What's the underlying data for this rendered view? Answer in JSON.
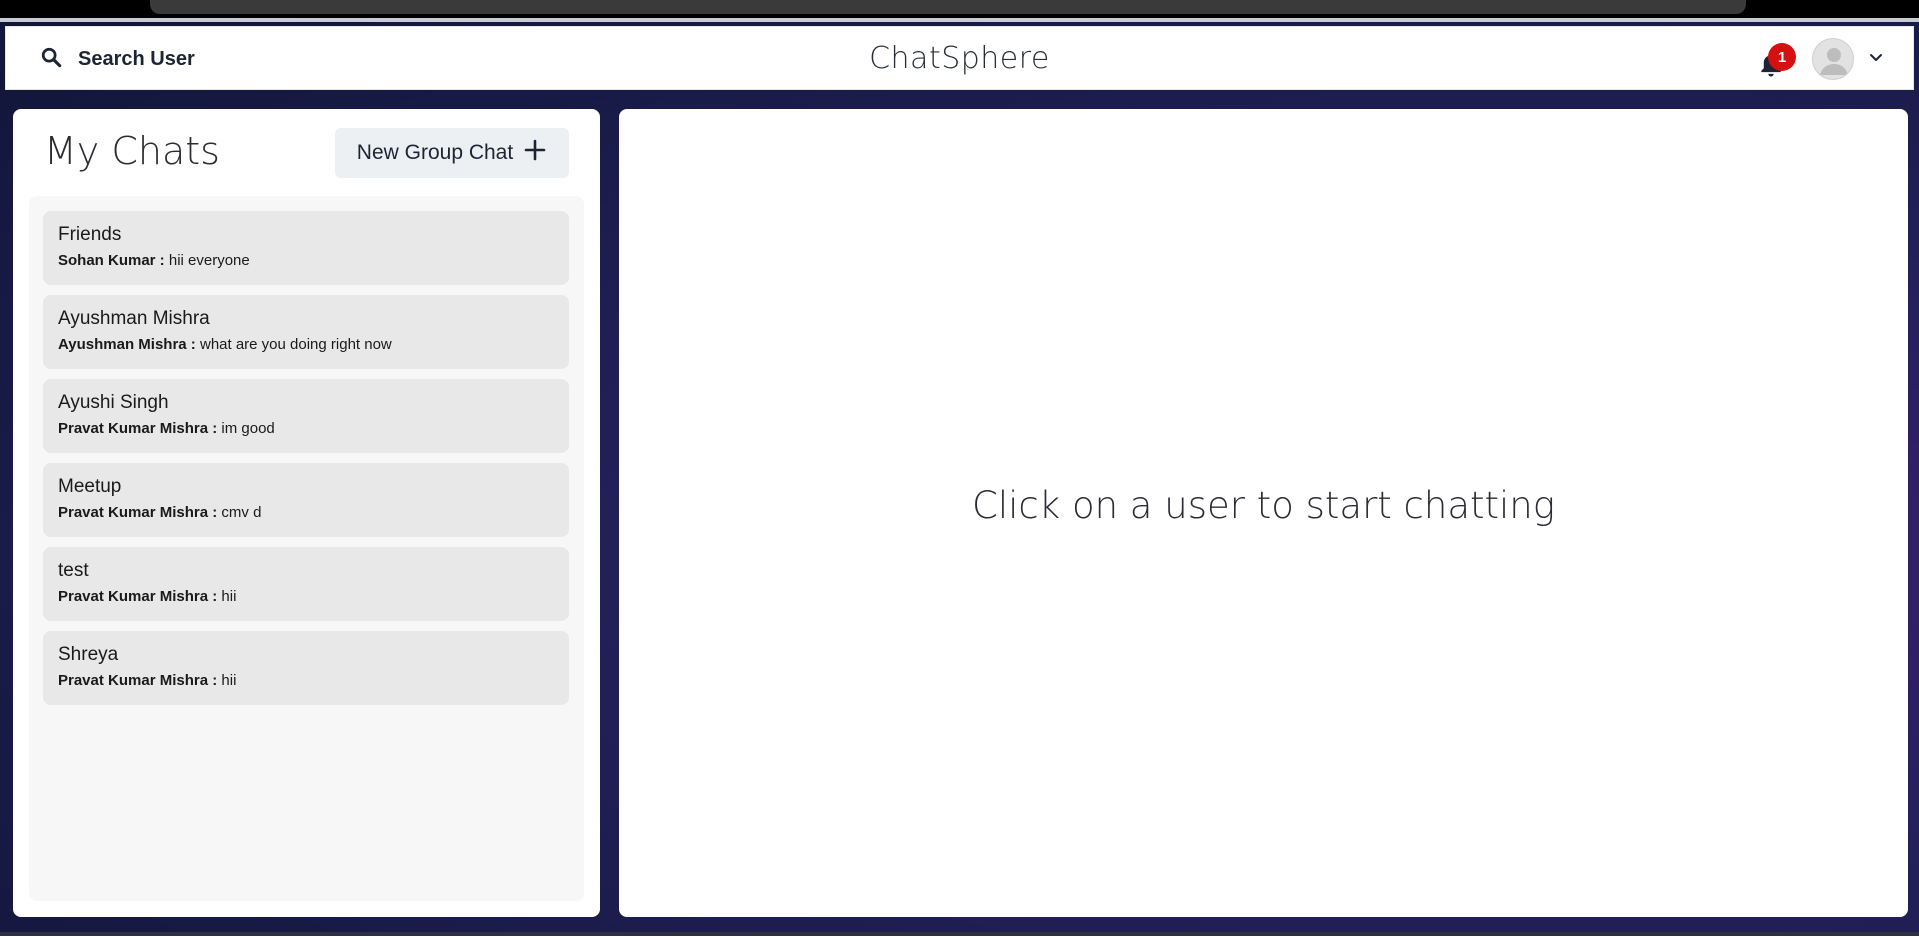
{
  "header": {
    "search_label": "Search User",
    "app_title": "ChatSphere",
    "notification_count": "1"
  },
  "sidebar": {
    "title": "My Chats",
    "new_group_label": "New Group Chat",
    "chats": [
      {
        "name": "Friends",
        "sender": "Sohan Kumar :",
        "message": "hii everyone"
      },
      {
        "name": "Ayushman Mishra",
        "sender": "Ayushman Mishra :",
        "message": "what are you doing right now"
      },
      {
        "name": "Ayushi Singh",
        "sender": "Pravat Kumar Mishra :",
        "message": "im good"
      },
      {
        "name": "Meetup",
        "sender": "Pravat Kumar Mishra :",
        "message": "cmv d"
      },
      {
        "name": "test",
        "sender": "Pravat Kumar Mishra :",
        "message": "hii"
      },
      {
        "name": "Shreya",
        "sender": "Pravat Kumar Mishra :",
        "message": "hii"
      }
    ]
  },
  "main": {
    "empty_message": "Click on a user to start chatting"
  },
  "icons": {
    "search": "search-icon",
    "bell": "bell-icon",
    "avatar": "user-avatar-icon",
    "chevron": "chevron-down-icon",
    "plus": "plus-icon"
  },
  "colors": {
    "background": "#24205a",
    "badge": "#d41010",
    "chat_item": "#e8e8e8",
    "button": "#edf0f3"
  }
}
